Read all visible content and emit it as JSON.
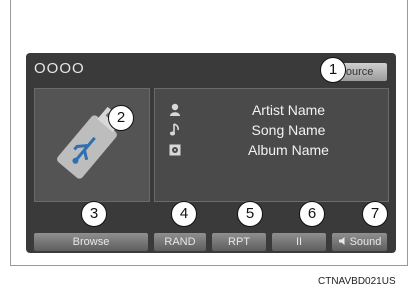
{
  "screen": {
    "source_name": "OOOO",
    "source_button": "Source"
  },
  "now_playing": {
    "artist": "Artist Name",
    "song": "Song Name",
    "album": "Album Name",
    "icons": [
      "artist-icon",
      "music-note-icon",
      "album-icon"
    ]
  },
  "device": {
    "icon": "usb-drive-icon"
  },
  "controls": {
    "browse": "Browse",
    "rand": "RAND",
    "rpt": "RPT",
    "pause": "II",
    "sound": "Sound",
    "sound_icon": "speaker-icon"
  },
  "callouts": [
    "1",
    "2",
    "3",
    "4",
    "5",
    "6",
    "7"
  ],
  "figure_code": "CTNAVBD021US",
  "colors": {
    "screen_bg": "#3a3a3a",
    "panel_bg": "#4a4a4a",
    "button_top": "#8f8f8f",
    "button_bottom": "#5e5e5e"
  }
}
